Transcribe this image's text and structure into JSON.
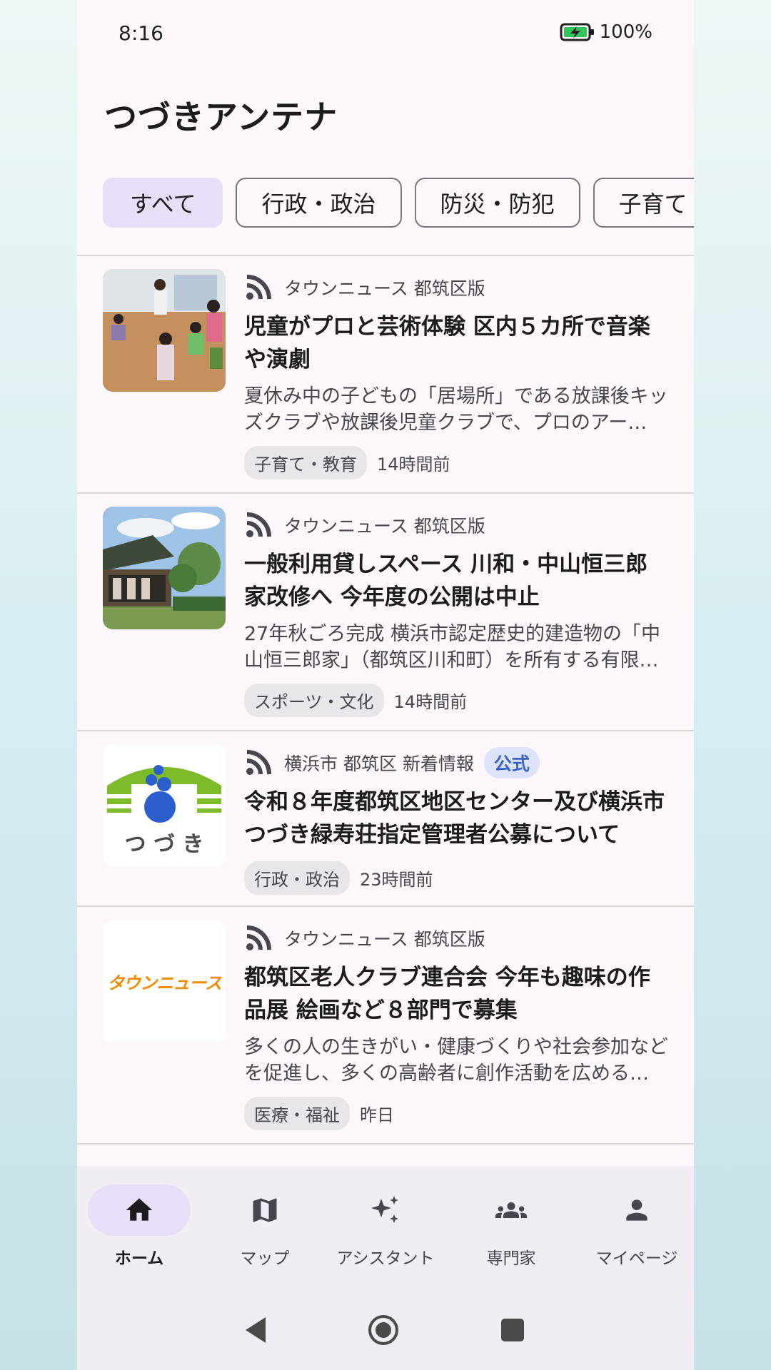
{
  "status": {
    "time": "8:16",
    "battery": "100",
    "battery_unit": "%"
  },
  "app": {
    "title": "つづきアンテナ"
  },
  "filters": [
    "すべて",
    "行政・政治",
    "防災・防犯",
    "子育て"
  ],
  "feed": [
    {
      "source": "タウンニュース 都筑区版",
      "title": "児童がプロと芸術体験 区内５カ所で音楽や演劇",
      "snippet": "夏休み中の子どもの「居場所」である放課後キッズクラブや放課後児童クラブで、プロのアー…",
      "tag": "子育て・教育",
      "time": "14時間前"
    },
    {
      "source": "タウンニュース 都筑区版",
      "title": "一般利用貸しスペース 川和・中山恒三郎家改修へ 今年度の公開は中止",
      "snippet": "27年秋ごろ完成 横浜市認定歴史的建造物の「中山恒三郎家」（都筑区川和町）を所有する有限…",
      "tag": "スポーツ・文化",
      "time": "14時間前"
    },
    {
      "source": "横浜市 都筑区 新着情報",
      "badge": "公式",
      "title": "令和８年度都筑区地区センター及び横浜市つづき緑寿荘指定管理者公募について",
      "tag": "行政・政治",
      "time": "23時間前",
      "logo_text": "つ づ き"
    },
    {
      "source": "タウンニュース 都筑区版",
      "title": "都筑区老人クラブ連合会 今年も趣味の作品展 絵画など８部門で募集",
      "snippet": "多くの人の生きがい・健康づくりや社会参加などを促進し、多くの高齢者に創作活動を広める…",
      "tag": "医療・福祉",
      "time": "昨日",
      "logo_text": "タウンニュース"
    }
  ],
  "nav": [
    "ホーム",
    "マップ",
    "アシスタント",
    "専門家",
    "マイページ"
  ],
  "colors": {
    "accent": "#e8def8",
    "official": "#3a63c8",
    "logo_green": "#7dbb2a",
    "logo_blue": "#2c5fce",
    "townnews_orange": "#f08a00"
  }
}
